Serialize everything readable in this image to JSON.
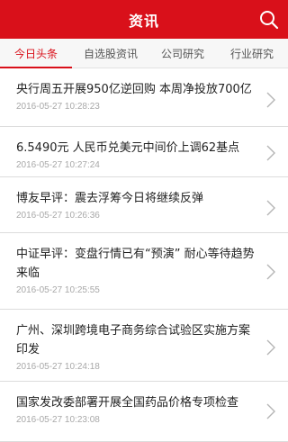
{
  "header": {
    "title": "资讯",
    "search_icon": "search-icon",
    "background": "#d9101a"
  },
  "tabs": [
    {
      "label": "今日头条",
      "active": true
    },
    {
      "label": "自选股资讯",
      "active": false
    },
    {
      "label": "公司研究",
      "active": false
    },
    {
      "label": "行业研究",
      "active": false
    }
  ],
  "news": [
    {
      "headline": "央行周五开展950亿逆回购 本周净投放700亿",
      "time": "2016-05-27 10:28:23"
    },
    {
      "headline": "6.5490元 人民币兑美元中间价上调62基点",
      "time": "2016-05-27 10:27:24"
    },
    {
      "headline": "博友早评：震去浮筹今日将继续反弹",
      "time": "2016-05-27 10:26:36"
    },
    {
      "headline": "中证早评：变盘行情已有“预演” 耐心等待趋势来临",
      "time": "2016-05-27 10:25:55"
    },
    {
      "headline": "广州、深圳跨境电子商务综合试验区实施方案印发",
      "time": "2016-05-27 10:24:18"
    },
    {
      "headline": "国家发改委部署开展全国药品价格专项检查",
      "time": "2016-05-27 10:23:08"
    }
  ]
}
